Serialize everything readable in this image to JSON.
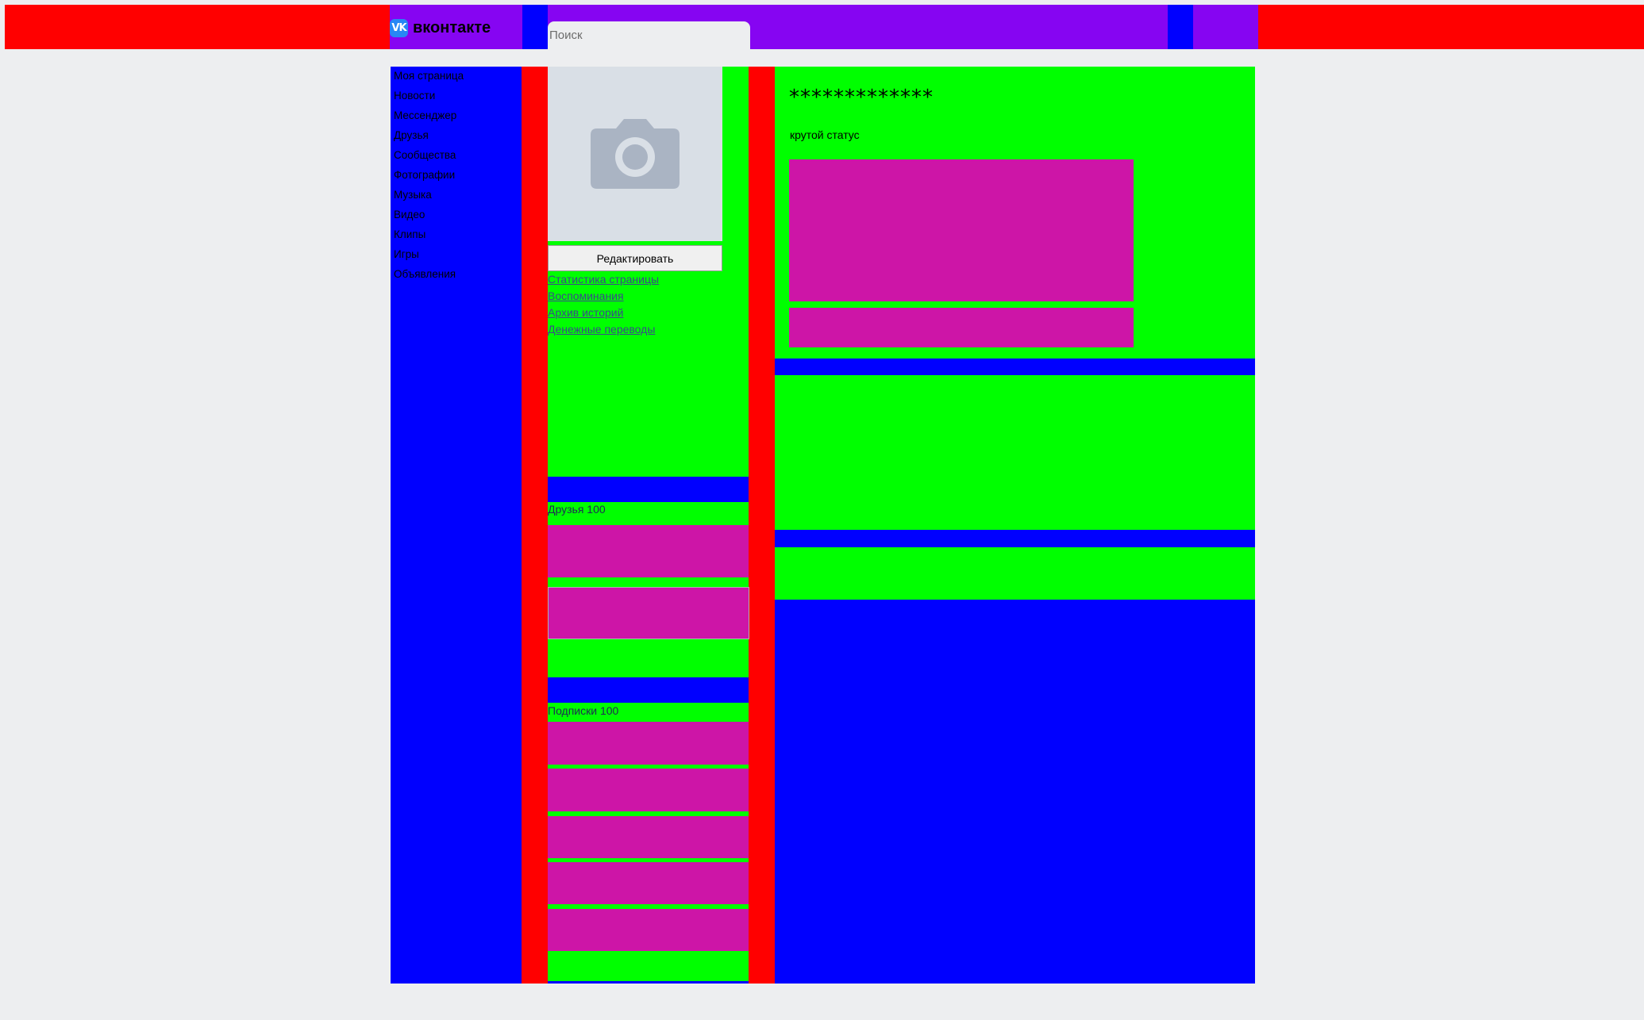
{
  "header": {
    "logo_text": "вконтакте",
    "logo_icon": "vk-logo-icon",
    "search_placeholder": "Поиск"
  },
  "nav": {
    "items": [
      {
        "label": "Моя страница"
      },
      {
        "label": "Новости"
      },
      {
        "label": "Мессенджер"
      },
      {
        "label": "Друзья"
      },
      {
        "label": "Сообщества"
      },
      {
        "label": "Фотографии"
      },
      {
        "label": "Музыка"
      },
      {
        "label": "Видео"
      },
      {
        "label": "Клипы"
      },
      {
        "label": "Игры"
      },
      {
        "label": "Объявления"
      }
    ]
  },
  "profile": {
    "photo_icon": "camera-icon",
    "edit_button": "Редактировать",
    "links": [
      {
        "label": "Статистика страницы"
      },
      {
        "label": "Воспоминания"
      },
      {
        "label": "Архив историй"
      },
      {
        "label": "Денежные переводы"
      }
    ],
    "friends_heading": "Друзья 100",
    "subscriptions_heading": "Подписки 100",
    "name": "*************",
    "status": "крутой статус"
  },
  "colors": {
    "red": "#ff0000",
    "blue": "#0000ff",
    "green": "#00ff00",
    "purple": "#8605f2",
    "magenta": "#cd15a7",
    "background": "#edeef0"
  }
}
